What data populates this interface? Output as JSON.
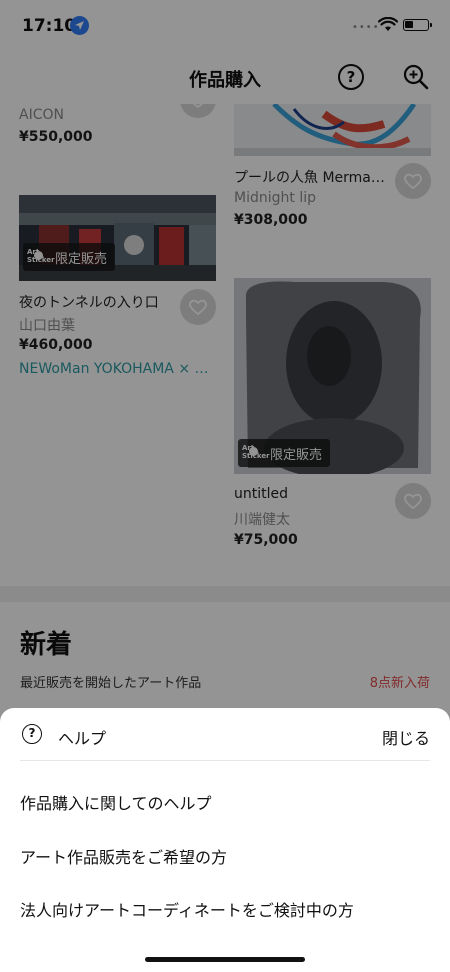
{
  "status_bar": {
    "time": "17:10"
  },
  "nav": {
    "title": "作品購入"
  },
  "grid": {
    "left_top": {
      "artist": "AICON",
      "price": "¥550,000"
    },
    "right_top": {
      "title": "プールの人魚 Merma…",
      "artist": "Midnight lip",
      "price": "¥308,000"
    },
    "left_card": {
      "badge": "限定販売",
      "title": "夜のトンネルの入り口",
      "artist": "山口由葉",
      "price": "¥460,000",
      "link": "NEWoMan YOKOHAMA × T…"
    },
    "right_card": {
      "badge": "限定販売",
      "title": "untitled",
      "artist": "川端健太",
      "price": "¥75,000"
    },
    "badge_logo": "Art Sticker"
  },
  "new_section": {
    "title": "新着",
    "subtitle": "最近販売を開始したアート作品",
    "count": "8点新入荷"
  },
  "sheet": {
    "title": "ヘルプ",
    "close_label": "閉じる",
    "items": [
      "作品購入に関してのヘルプ",
      "アート作品販売をご希望の方",
      "法人向けアートコーディネートをご検討中の方"
    ]
  },
  "colors": {
    "accent_link": "#2e9aa4",
    "new_count": "#e14b4b",
    "location_badge": "#2f7cf6"
  }
}
